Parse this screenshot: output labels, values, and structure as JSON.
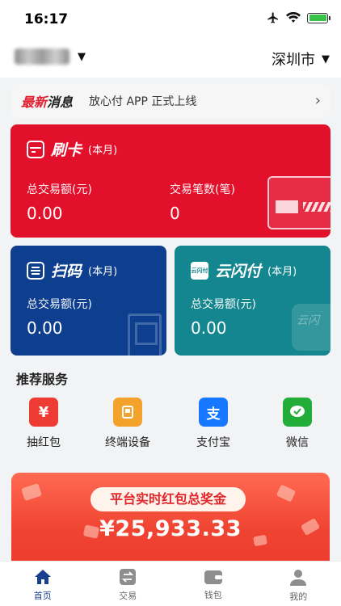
{
  "status": {
    "time": "16:17"
  },
  "header": {
    "city": "深圳市"
  },
  "news": {
    "tag_red": "最新",
    "tag_dark": "消息",
    "text": "放心付 APP 正式上线"
  },
  "cards": {
    "swipe": {
      "name": "刷卡",
      "period": "(本月)",
      "amount_label": "总交易额(元)",
      "amount_value": "0.00",
      "count_label": "交易笔数(笔)",
      "count_value": "0"
    },
    "scan": {
      "name": "扫码",
      "period": "(本月)",
      "amount_label": "总交易额(元)",
      "amount_value": "0.00"
    },
    "union": {
      "name": "云闪付",
      "period": "(本月)",
      "amount_label": "总交易额(元)",
      "amount_value": "0.00",
      "logo_text": "云闪付",
      "deco_text": "云闪"
    }
  },
  "services": {
    "title": "推荐服务",
    "items": [
      {
        "label": "抽红包",
        "icon": "red-envelope-icon",
        "color": "#ee3b34",
        "glyph": "¥"
      },
      {
        "label": "终端设备",
        "icon": "device-icon",
        "color": "#f3a32b",
        "glyph": "▭"
      },
      {
        "label": "支付宝",
        "icon": "alipay-icon",
        "color": "#1677ff",
        "glyph": "支"
      },
      {
        "label": "微信",
        "icon": "wechat-icon",
        "color": "#22ad38",
        "glyph": "✓"
      }
    ]
  },
  "banner": {
    "title": "平台实时红包总奖金",
    "amount": "¥25,933.33"
  },
  "tabs": [
    {
      "label": "首页",
      "icon": "home-icon"
    },
    {
      "label": "交易",
      "icon": "exchange-icon"
    },
    {
      "label": "钱包",
      "icon": "wallet-icon"
    },
    {
      "label": "我的",
      "icon": "profile-icon"
    }
  ],
  "colors": {
    "swipe": "#e3102c",
    "scan": "#0e3f8f",
    "union": "#13868f",
    "active_tab": "#1b3f8f"
  }
}
